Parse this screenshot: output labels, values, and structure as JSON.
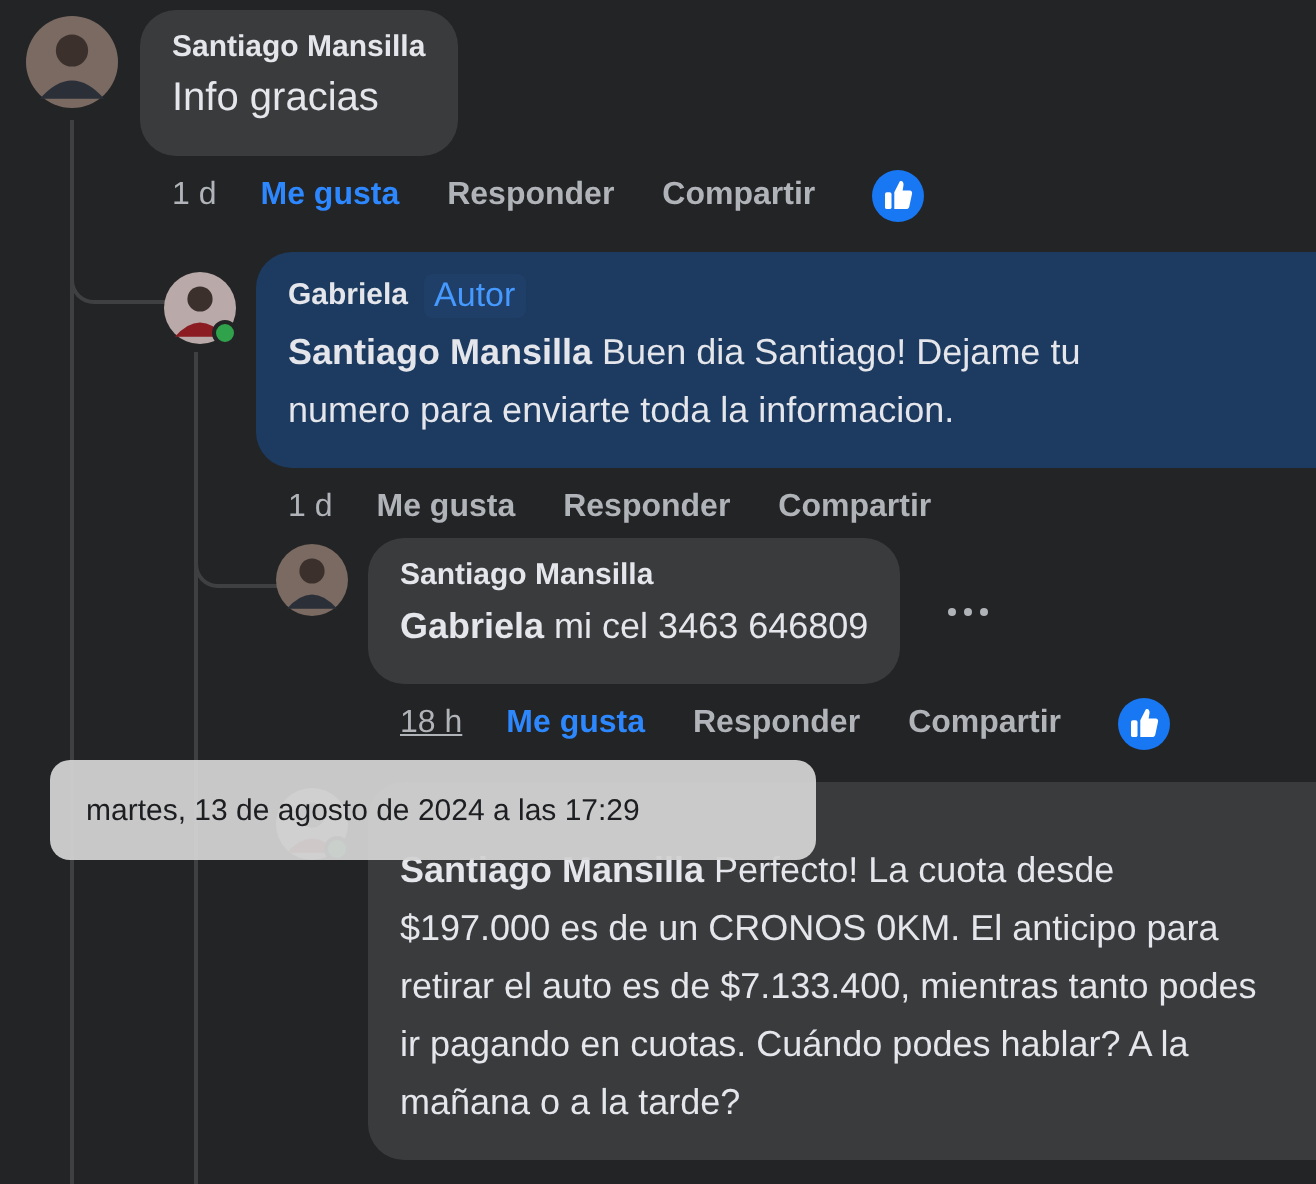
{
  "comments": [
    {
      "author": "Santiago Mansilla",
      "text": "Info gracias",
      "online": false,
      "time": "1 d",
      "time_hovered": false,
      "actions": [
        {
          "label": "Me gusta",
          "selected": true
        },
        {
          "label": "Responder",
          "selected": false
        },
        {
          "label": "Compartir",
          "selected": false
        }
      ],
      "reacted": true,
      "more_menu": false,
      "children": [
        {
          "author": "Gabriela",
          "badge": "Autor",
          "text": "**Santiago Mansilla** Buen dia Santiago! Dejame tu numero para enviarte toda la informacion.",
          "online": true,
          "time": "1 d",
          "time_hovered": false,
          "actions": [
            {
              "label": "Me gusta",
              "selected": false
            },
            {
              "label": "Responder",
              "selected": false
            },
            {
              "label": "Compartir",
              "selected": false
            }
          ],
          "reacted": false,
          "more_menu": false,
          "children": [
            {
              "author": "Santiago Mansilla",
              "text": "**Gabriela** mi cel 3463 646809",
              "online": false,
              "time": "18 h",
              "time_hovered": true,
              "actions": [
                {
                  "label": "Me gusta",
                  "selected": true
                },
                {
                  "label": "Responder",
                  "selected": false
                },
                {
                  "label": "Compartir",
                  "selected": false
                }
              ],
              "reacted": true,
              "more_menu": true
            },
            {
              "text": "**Santiago Mansilla** Perfecto! La cuota desde $197.000 es de un CRONOS 0KM. El anticipo para retirar el auto es de $7.133.400, mientras tanto podes ir pagando en cuotas. Cuándo podes hablar? A la mañana o a la tarde?",
              "online": true,
              "reacted": false,
              "more_menu": false
            }
          ]
        }
      ]
    }
  ],
  "tooltip": {
    "text": "martes, 13 de agosto de 2024 a las 17:29"
  }
}
